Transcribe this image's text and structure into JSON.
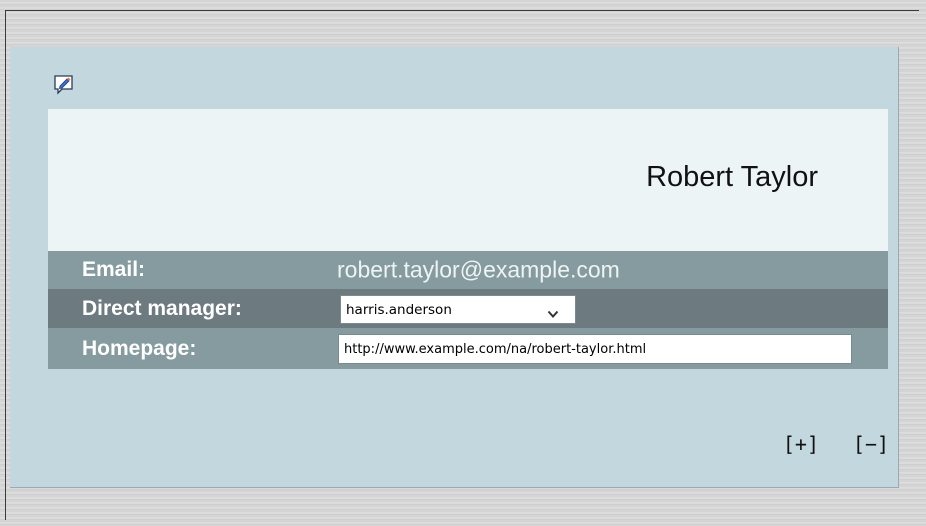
{
  "icons": {
    "edit": "edit-note-icon",
    "dropdown": "chevron-down-icon"
  },
  "profile": {
    "name": "Robert Taylor",
    "email_label": "Email:",
    "email_value": "robert.taylor@example.com",
    "manager_label": "Direct manager:",
    "manager_value": "harris.anderson",
    "homepage_label": "Homepage:",
    "homepage_value": "http://www.example.com/na/robert-taylor.html"
  },
  "controls": {
    "expand_label": "[+]",
    "collapse_label": "[−]"
  },
  "colors": {
    "card_bg": "#c3d8de",
    "name_panel_bg": "#ecf4f6",
    "row_light": "#869b9f",
    "row_dark": "#6d7b80"
  }
}
